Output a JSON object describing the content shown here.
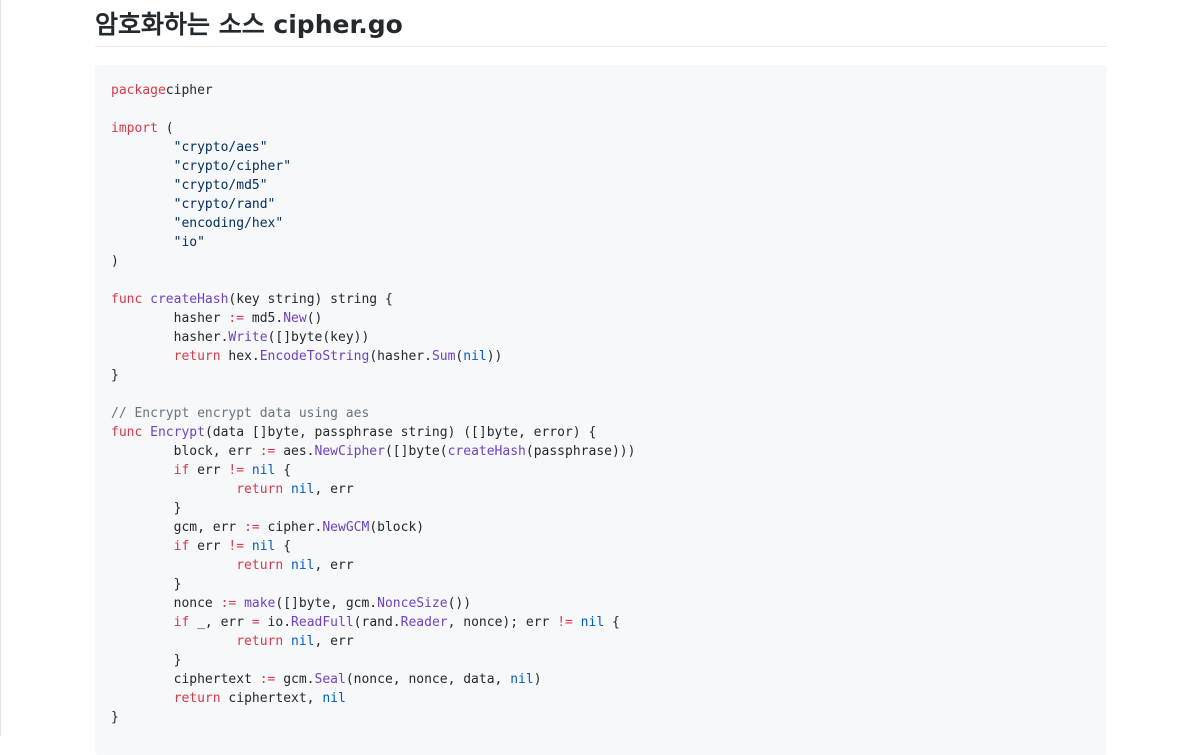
{
  "page": {
    "title": "암호화하는 소스 cipher.go"
  },
  "colors": {
    "keyword": "#d73a49",
    "function": "#6f42c1",
    "constant": "#005cc5",
    "string": "#032f62",
    "comment": "#6a737d",
    "plain": "#24292e",
    "code_background": "#f6f8fa"
  },
  "code": {
    "language": "go",
    "lines": [
      [
        [
          "kw",
          "package"
        ],
        [
          "",
          "cipher"
        ]
      ],
      [],
      [
        [
          "kw",
          "import"
        ],
        [
          "",
          " ("
        ]
      ],
      [
        [
          "",
          "\t"
        ],
        [
          "st",
          "\"crypto/aes\""
        ]
      ],
      [
        [
          "",
          "\t"
        ],
        [
          "st",
          "\"crypto/cipher\""
        ]
      ],
      [
        [
          "",
          "\t"
        ],
        [
          "st",
          "\"crypto/md5\""
        ]
      ],
      [
        [
          "",
          "\t"
        ],
        [
          "st",
          "\"crypto/rand\""
        ]
      ],
      [
        [
          "",
          "\t"
        ],
        [
          "st",
          "\"encoding/hex\""
        ]
      ],
      [
        [
          "",
          "\t"
        ],
        [
          "st",
          "\"io\""
        ]
      ],
      [
        [
          "",
          ")"
        ]
      ],
      [],
      [
        [
          "kw",
          "func"
        ],
        [
          "",
          " "
        ],
        [
          "fn",
          "createHash"
        ],
        [
          "",
          "(key string) string {"
        ]
      ],
      [
        [
          "",
          "\thasher "
        ],
        [
          "kw",
          ":="
        ],
        [
          "",
          " md5."
        ],
        [
          "fn",
          "New"
        ],
        [
          "",
          "()"
        ]
      ],
      [
        [
          "",
          "\thasher."
        ],
        [
          "fn",
          "Write"
        ],
        [
          "",
          "([]byte(key))"
        ]
      ],
      [
        [
          "",
          "\t"
        ],
        [
          "kw",
          "return"
        ],
        [
          "",
          " hex."
        ],
        [
          "fn",
          "EncodeToString"
        ],
        [
          "",
          "(hasher."
        ],
        [
          "fn",
          "Sum"
        ],
        [
          "",
          "("
        ],
        [
          "cn",
          "nil"
        ],
        [
          "",
          "))"
        ]
      ],
      [
        [
          "",
          "}"
        ]
      ],
      [],
      [
        [
          "cm",
          "// Encrypt encrypt data using aes"
        ]
      ],
      [
        [
          "kw",
          "func"
        ],
        [
          "",
          " "
        ],
        [
          "fn",
          "Encrypt"
        ],
        [
          "",
          "(data []byte, passphrase string) ([]byte, error) {"
        ]
      ],
      [
        [
          "",
          "\tblock, err "
        ],
        [
          "kw",
          ":="
        ],
        [
          "",
          " aes."
        ],
        [
          "fn",
          "NewCipher"
        ],
        [
          "",
          "([]byte("
        ],
        [
          "fn",
          "createHash"
        ],
        [
          "",
          "(passphrase)))"
        ]
      ],
      [
        [
          "",
          "\t"
        ],
        [
          "kw",
          "if"
        ],
        [
          "",
          " err "
        ],
        [
          "kw",
          "!="
        ],
        [
          "",
          " "
        ],
        [
          "cn",
          "nil"
        ],
        [
          "",
          " {"
        ]
      ],
      [
        [
          "",
          "\t\t"
        ],
        [
          "kw",
          "return"
        ],
        [
          "",
          " "
        ],
        [
          "cn",
          "nil"
        ],
        [
          "",
          ", err"
        ]
      ],
      [
        [
          "",
          "\t}"
        ]
      ],
      [
        [
          "",
          "\tgcm, err "
        ],
        [
          "kw",
          ":="
        ],
        [
          "",
          " cipher."
        ],
        [
          "fn",
          "NewGCM"
        ],
        [
          "",
          "(block)"
        ]
      ],
      [
        [
          "",
          "\t"
        ],
        [
          "kw",
          "if"
        ],
        [
          "",
          " err "
        ],
        [
          "kw",
          "!="
        ],
        [
          "",
          " "
        ],
        [
          "cn",
          "nil"
        ],
        [
          "",
          " {"
        ]
      ],
      [
        [
          "",
          "\t\t"
        ],
        [
          "kw",
          "return"
        ],
        [
          "",
          " "
        ],
        [
          "cn",
          "nil"
        ],
        [
          "",
          ", err"
        ]
      ],
      [
        [
          "",
          "\t}"
        ]
      ],
      [
        [
          "",
          "\tnonce "
        ],
        [
          "kw",
          ":="
        ],
        [
          "",
          " "
        ],
        [
          "fn",
          "make"
        ],
        [
          "",
          "([]byte, gcm."
        ],
        [
          "fn",
          "NonceSize"
        ],
        [
          "",
          "())"
        ]
      ],
      [
        [
          "",
          "\t"
        ],
        [
          "kw",
          "if"
        ],
        [
          "",
          " _, err "
        ],
        [
          "kw",
          "="
        ],
        [
          "",
          " io."
        ],
        [
          "fn",
          "ReadFull"
        ],
        [
          "",
          "(rand."
        ],
        [
          "fn",
          "Reader"
        ],
        [
          "",
          ", nonce); err "
        ],
        [
          "kw",
          "!="
        ],
        [
          "",
          " "
        ],
        [
          "cn",
          "nil"
        ],
        [
          "",
          " {"
        ]
      ],
      [
        [
          "",
          "\t\t"
        ],
        [
          "kw",
          "return"
        ],
        [
          "",
          " "
        ],
        [
          "cn",
          "nil"
        ],
        [
          "",
          ", err"
        ]
      ],
      [
        [
          "",
          "\t}"
        ]
      ],
      [
        [
          "",
          "\tciphertext "
        ],
        [
          "kw",
          ":="
        ],
        [
          "",
          " gcm."
        ],
        [
          "fn",
          "Seal"
        ],
        [
          "",
          "(nonce, nonce, data, "
        ],
        [
          "cn",
          "nil"
        ],
        [
          "",
          ")"
        ]
      ],
      [
        [
          "",
          "\t"
        ],
        [
          "kw",
          "return"
        ],
        [
          "",
          " ciphertext, "
        ],
        [
          "cn",
          "nil"
        ]
      ],
      [
        [
          "",
          "}"
        ]
      ]
    ]
  }
}
